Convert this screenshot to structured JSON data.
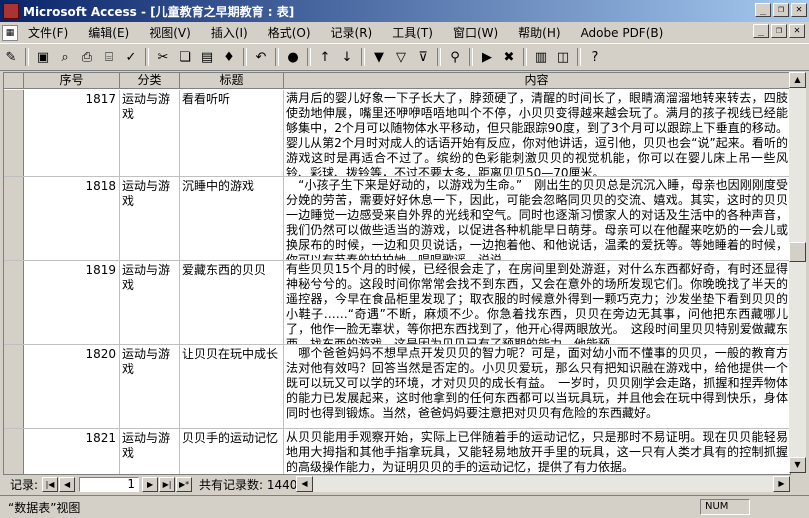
{
  "window": {
    "title": "Microsoft Access - [儿童教育之早期教育 : 表]"
  },
  "menu": {
    "items": [
      "文件(F)",
      "编辑(E)",
      "视图(V)",
      "插入(I)",
      "格式(O)",
      "记录(R)",
      "工具(T)",
      "窗口(W)",
      "帮助(H)",
      "Adobe PDF(B)"
    ]
  },
  "columns": {
    "id": "序号",
    "category": "分类",
    "title": "标题",
    "content": "内容"
  },
  "rows": [
    {
      "id": "1817",
      "category": "运动与游戏",
      "title": "看看听听",
      "content": "满月后的婴儿好象一下子长大了，脖颈硬了，清醒的时间长了，眼睛滴溜溜地转来转去，四肢使劲地伸展，嘴里还咿咿唔唔地叫个不停，小贝贝变得越来越会玩了。满月的孩子视线已经能够集中，2个月可以随物体水平移动，但只能跟踪90度，到了3个月可以跟踪上下垂直的移动。婴儿从第2个月时对成人的话语开始有反应，你对他讲话，逗引他，贝贝也会“说”起来。看听的游戏这时是再适合不过了。缤纷的色彩能刺激贝贝的视觉机能，你可以在婴儿床上吊一些风铃、彩球、拨铃等，不过不要太多，距离贝贝50—70厘米。"
    },
    {
      "id": "1818",
      "category": "运动与游戏",
      "title": "沉睡中的游戏",
      "content": "　“小孩子生下来是好动的，以游戏为生命。”　刚出生的贝贝总是沉沉入睡，母亲也因刚刚度受分娩的劳苦，需要好好休息一下，因此，可能会忽略同贝贝的交流、嬉戏。其实，这时的贝贝一边睡觉一边感受来自外界的光线和空气。同时也逐渐习惯家人的对话及生活中的各种声音，我们仍然可以做些适当的游戏，以促进各种机能早日萌芽。母亲可以在他醒来吃奶的一会儿或换尿布的时候，一边和贝贝说话，一边抱着他、和他说话，温柔的爱抚等。等她睡着的时候，你可以有节奏的拍拍她，唱唱歌谣，说说"
    },
    {
      "id": "1819",
      "category": "运动与游戏",
      "title": "爱藏东西的贝贝",
      "content": "有些贝贝15个月的时候，已经很会走了，在房间里到处游逛，对什么东西都好奇，有时还显得神秘兮兮的。这段时间你常常会找不到东西，又会在意外的场所发现它们。你晚晚找了半天的遥控器，今早在食品柜里发现了；取衣服的时候意外得到一颗巧克力；沙发坐垫下看到贝贝的小鞋子……“奇遇”不断，麻烦不少。你急着找东西，贝贝在旁边无其事，问他把东西藏哪儿了，他作一脸无辜状，等你把东西找到了，他开心得两眼放光。　这段时间里贝贝特别爱做藏东西，找东西的游戏。这是因为贝贝已有了预期的能力，他能预"
    },
    {
      "id": "1820",
      "category": "运动与游戏",
      "title": "让贝贝在玩中成长",
      "content": "　哪个爸爸妈妈不想早点开发贝贝的智力呢？可是，面对幼小而不懂事的贝贝，一般的教育方法对他有效吗？回答当然是否定的。小贝贝爱玩，那么只有把知识融在游戏中，给他提供一个既可以玩又可以学的环境，才对贝贝的成长有益。　一岁时，贝贝刚学会走路，抓握和捏弄物体的能力已发展起来，这时他拿到的任何东西都可以当玩具玩，并且他会在玩中得到快乐，身体同时也得到锻炼。当然，爸爸妈妈要注意把对贝贝有危险的东西藏好。"
    },
    {
      "id": "1821",
      "category": "运动与游戏",
      "title": "贝贝手的运动记忆",
      "content": "从贝贝能用手观察开始，实际上已伴随着手的运动记忆，只是那时不易证明。现在贝贝能轻易地用大拇指和其他手指拿玩具，又能轻易地放开手里的玩具，这一只有人类才具有的控制抓握的高级操作能力，为证明贝贝的手的运动记忆，提供了有力依据。"
    }
  ],
  "navigation": {
    "label": "记录:",
    "current_record": "1",
    "count_text": "共有记录数: 1440"
  },
  "status": {
    "view_text": "“数据表”视图",
    "num_indicator": "NUM"
  }
}
